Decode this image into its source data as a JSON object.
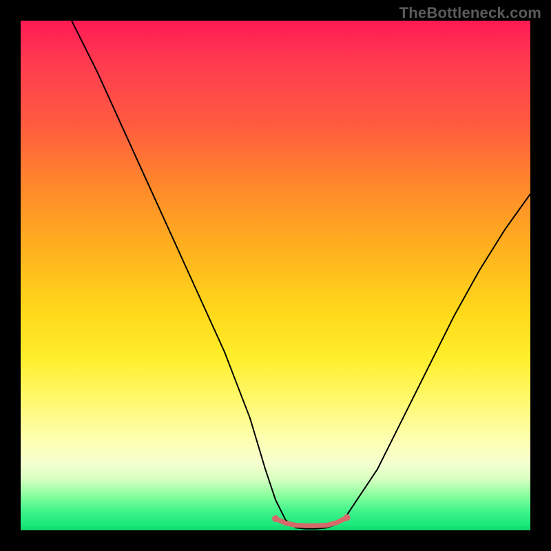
{
  "watermark": "TheBottleneck.com",
  "chart_data": {
    "type": "line",
    "title": "",
    "xlabel": "",
    "ylabel": "",
    "xlim": [
      0,
      100
    ],
    "ylim": [
      0,
      100
    ],
    "series": [
      {
        "name": "curve",
        "x": [
          10,
          15,
          20,
          25,
          30,
          35,
          40,
          45,
          48,
          50,
          52,
          54,
          56,
          58,
          60,
          62,
          64,
          70,
          75,
          80,
          85,
          90,
          95,
          100
        ],
        "values": [
          100,
          90,
          79,
          68,
          57,
          46,
          35,
          22,
          12,
          6,
          2,
          0.5,
          0.3,
          0.3,
          0.5,
          1.2,
          3,
          12,
          22,
          32,
          42,
          51,
          59,
          66
        ]
      },
      {
        "name": "flat-marker",
        "x": [
          50,
          52,
          54,
          56,
          58,
          60,
          62,
          64
        ],
        "values": [
          2.3,
          1.4,
          1.0,
          0.9,
          0.9,
          1.0,
          1.5,
          2.5
        ]
      }
    ],
    "annotations": []
  },
  "colors": {
    "curve": "#000000",
    "marker": "#d66a6a",
    "background_top": "#ff1a54",
    "background_bottom": "#0fd46a"
  }
}
